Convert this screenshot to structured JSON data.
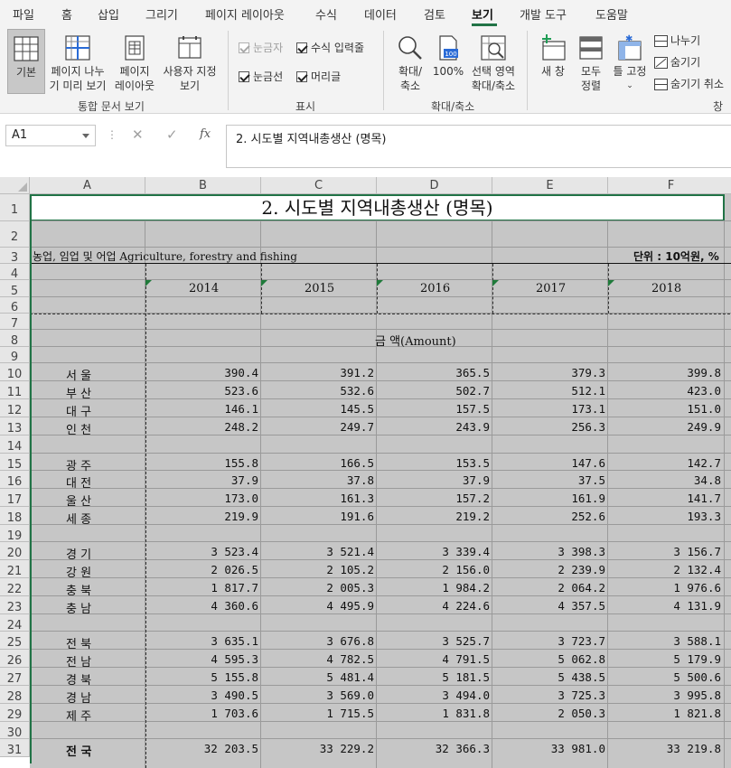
{
  "menu": {
    "tabs": [
      "파일",
      "홈",
      "삽입",
      "그리기",
      "페이지 레이아웃",
      "수식",
      "데이터",
      "검토",
      "보기",
      "개발 도구",
      "도움말"
    ],
    "active": "보기"
  },
  "ribbon": {
    "workbook_views": {
      "normal": "기본",
      "page_break_1": "페이지 나누",
      "page_break_2": "기 미리 보기",
      "page_layout_1": "페이지",
      "page_layout_2": "레이아웃",
      "custom_1": "사용자 지정",
      "custom_2": "보기",
      "group": "통합 문서 보기"
    },
    "show": {
      "ruler": "눈금자",
      "formula_bar": "수식 입력줄",
      "gridlines": "눈금선",
      "headings": "머리글",
      "group": "표시"
    },
    "zoom": {
      "zoom_1": "확대/",
      "zoom_2": "축소",
      "hundred": "100%",
      "selection_1": "선택 영역",
      "selection_2": "확대/축소",
      "group": "확대/축소"
    },
    "window": {
      "new_window": "새 창",
      "arrange_1": "모두",
      "arrange_2": "정렬",
      "freeze": "틀 고정",
      "split": "나누기",
      "hide": "숨기기",
      "unhide": "숨기기 취소",
      "group": "창"
    }
  },
  "formula_bar": {
    "name_box": "A1",
    "content": "2. 시도별 지역내총생산 (명목)"
  },
  "columns": [
    "A",
    "B",
    "C",
    "D",
    "E",
    "F"
  ],
  "sheet": {
    "title": "2. 시도별 지역내총생산 (명목)",
    "subtitle": "농업, 임업 및 어업  Agriculture, forestry and fishing",
    "unit": "단위 : 10억원, %",
    "years": [
      "2014",
      "2015",
      "2016",
      "2017",
      "2018"
    ],
    "amount_label": "금      액(Amount)",
    "rows": [
      {
        "n": 10,
        "region": "서  울",
        "values": [
          "390.4",
          "391.2",
          "365.5",
          "379.3",
          "399.8"
        ]
      },
      {
        "n": 11,
        "region": "부  산",
        "values": [
          "523.6",
          "532.6",
          "502.7",
          "512.1",
          "423.0"
        ]
      },
      {
        "n": 12,
        "region": "대  구",
        "values": [
          "146.1",
          "145.5",
          "157.5",
          "173.1",
          "151.0"
        ]
      },
      {
        "n": 13,
        "region": "인  천",
        "values": [
          "248.2",
          "249.7",
          "243.9",
          "256.3",
          "249.9"
        ]
      },
      {
        "n": 15,
        "region": "광  주",
        "values": [
          "155.8",
          "166.5",
          "153.5",
          "147.6",
          "142.7"
        ]
      },
      {
        "n": 16,
        "region": "대  전",
        "values": [
          "37.9",
          "37.8",
          "37.9",
          "37.5",
          "34.8"
        ]
      },
      {
        "n": 17,
        "region": "울  산",
        "values": [
          "173.0",
          "161.3",
          "157.2",
          "161.9",
          "141.7"
        ]
      },
      {
        "n": 18,
        "region": "세  종",
        "values": [
          "219.9",
          "191.6",
          "219.2",
          "252.6",
          "193.3"
        ]
      },
      {
        "n": 20,
        "region": "경  기",
        "values": [
          "3 523.4",
          "3 521.4",
          "3 339.4",
          "3 398.3",
          "3 156.7"
        ]
      },
      {
        "n": 21,
        "region": "강  원",
        "values": [
          "2 026.5",
          "2 105.2",
          "2 156.0",
          "2 239.9",
          "2 132.4"
        ]
      },
      {
        "n": 22,
        "region": "충  북",
        "values": [
          "1 817.7",
          "2 005.3",
          "1 984.2",
          "2 064.2",
          "1 976.6"
        ]
      },
      {
        "n": 23,
        "region": "충  남",
        "values": [
          "4 360.6",
          "4 495.9",
          "4 224.6",
          "4 357.5",
          "4 131.9"
        ]
      },
      {
        "n": 25,
        "region": "전  북",
        "values": [
          "3 635.1",
          "3 676.8",
          "3 525.7",
          "3 723.7",
          "3 588.1"
        ]
      },
      {
        "n": 26,
        "region": "전  남",
        "values": [
          "4 595.3",
          "4 782.5",
          "4 791.5",
          "5 062.8",
          "5 179.9"
        ]
      },
      {
        "n": 27,
        "region": "경  북",
        "values": [
          "5 155.8",
          "5 481.4",
          "5 181.5",
          "5 438.5",
          "5 500.6"
        ]
      },
      {
        "n": 28,
        "region": "경  남",
        "values": [
          "3 490.5",
          "3 569.0",
          "3 494.0",
          "3 725.3",
          "3 995.8"
        ]
      },
      {
        "n": 29,
        "region": "제  주",
        "values": [
          "1 703.6",
          "1 715.5",
          "1 831.8",
          "2 050.3",
          "1 821.8"
        ]
      },
      {
        "n": 31,
        "region": "전  국",
        "values": [
          "32 203.5",
          "33 229.2",
          "32 366.3",
          "33 981.0",
          "33 219.8"
        ]
      }
    ]
  },
  "row_numbers": [
    "1",
    "2",
    "3",
    "4",
    "5",
    "6",
    "7",
    "8",
    "9",
    "10",
    "11",
    "12",
    "13",
    "14",
    "15",
    "16",
    "17",
    "18",
    "19",
    "20",
    "21",
    "22",
    "23",
    "24",
    "25",
    "26",
    "27",
    "28",
    "29",
    "30",
    "31"
  ],
  "colors": {
    "accent": "#217346",
    "selection": "#c6c6c6"
  }
}
